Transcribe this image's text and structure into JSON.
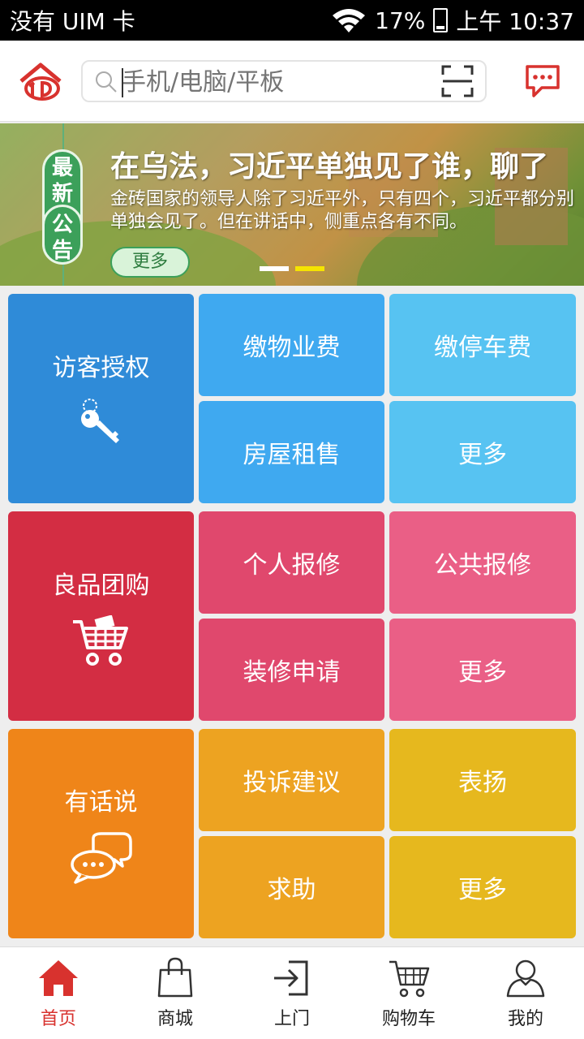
{
  "status_bar": {
    "carrier": "没有 UIM 卡",
    "battery": "17%",
    "time": "上午 10:37"
  },
  "header": {
    "search_placeholder": "手机/电脑/平板",
    "icons": [
      "logo-icon",
      "search-icon",
      "scan-icon",
      "message-icon"
    ]
  },
  "banner": {
    "badge": [
      "最",
      "新",
      "公",
      "告"
    ],
    "title": "在乌法，习近平单独见了谁，聊了",
    "description": "金砖国家的领导人除了习近平外，只有四个，习近平都分别单独会见了。但在讲话中，侧重点各有不同。",
    "more_label": "更多",
    "dots": {
      "count": 2,
      "active_index": 1,
      "inactive_color": "#ffffff",
      "active_color": "#f5e400"
    }
  },
  "sections": [
    {
      "main": {
        "label": "访客授权",
        "icon": "key-icon",
        "color": "#2f8bd8"
      },
      "items": [
        {
          "label": "缴物业费",
          "color": "#3fa9f0"
        },
        {
          "label": "缴停车费",
          "color": "#57c3f2"
        },
        {
          "label": "房屋租售",
          "color": "#3fa9f0"
        },
        {
          "label": "更多",
          "color": "#57c3f2"
        }
      ]
    },
    {
      "main": {
        "label": "良品团购",
        "icon": "shopping-cart-icon",
        "color": "#d32d43"
      },
      "items": [
        {
          "label": "个人报修",
          "color": "#e0486d"
        },
        {
          "label": "公共报修",
          "color": "#ea5f86"
        },
        {
          "label": "装修申请",
          "color": "#e0486d"
        },
        {
          "label": "更多",
          "color": "#ea5f86"
        }
      ]
    },
    {
      "main": {
        "label": "有话说",
        "icon": "chat-bubbles-icon",
        "color": "#ef8519"
      },
      "items": [
        {
          "label": "投诉建议",
          "color": "#eda321"
        },
        {
          "label": "表扬",
          "color": "#e6b81e"
        },
        {
          "label": "求助",
          "color": "#eda321"
        },
        {
          "label": "更多",
          "color": "#e6b81e"
        }
      ]
    }
  ],
  "tabbar": {
    "items": [
      {
        "label": "首页",
        "icon": "home-icon",
        "active": true
      },
      {
        "label": "商城",
        "icon": "shopping-bag-icon",
        "active": false
      },
      {
        "label": "上门",
        "icon": "sign-in-icon",
        "active": false
      },
      {
        "label": "购物车",
        "icon": "cart-icon",
        "active": false
      },
      {
        "label": "我的",
        "icon": "user-icon",
        "active": false
      }
    ],
    "active_color": "#d8322e"
  }
}
